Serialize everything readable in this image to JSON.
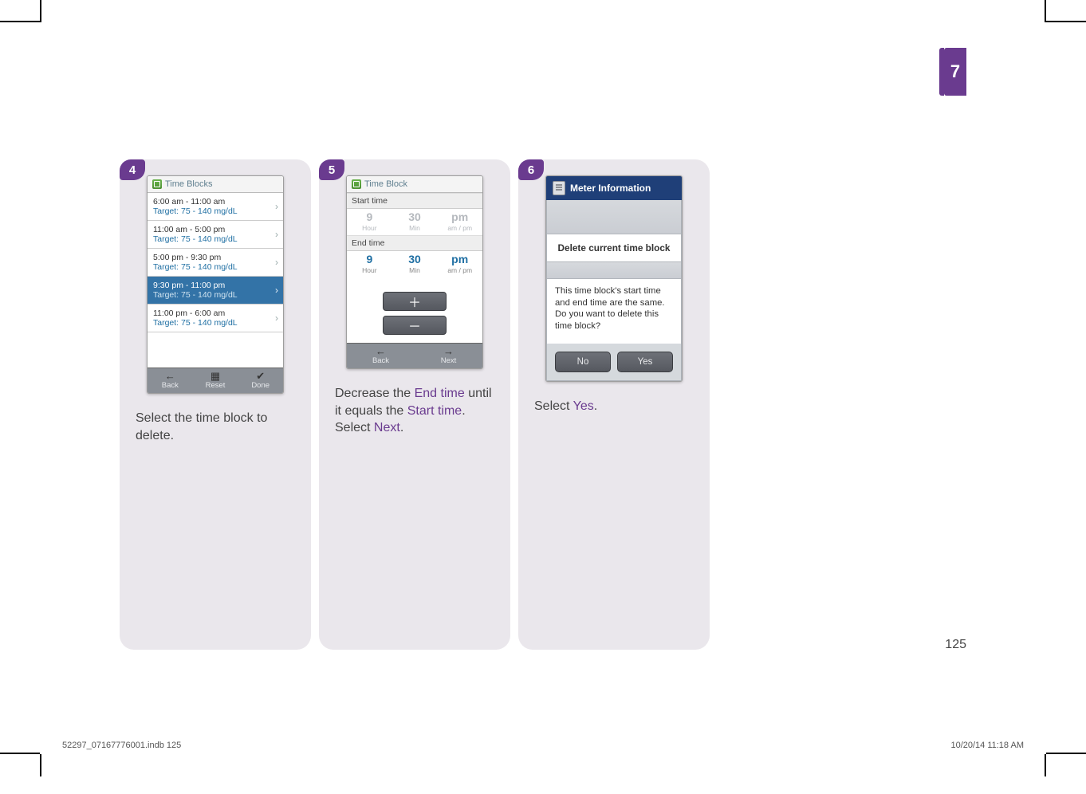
{
  "chapter_tab": "7",
  "page_number": "125",
  "footer": {
    "left": "52297_07167776001.indb   125",
    "right": "10/20/14   11:18 AM"
  },
  "steps": {
    "s4": {
      "badge": "4",
      "header": "Time Blocks",
      "blocks": [
        {
          "time": "6:00 am - 11:00 am",
          "target": "Target: 75 - 140 mg/dL"
        },
        {
          "time": "11:00 am - 5:00 pm",
          "target": "Target: 75 - 140 mg/dL"
        },
        {
          "time": "5:00 pm - 9:30 pm",
          "target": "Target: 75 - 140 mg/dL"
        },
        {
          "time": "9:30 pm - 11:00 pm",
          "target": "Target: 75 - 140 mg/dL"
        },
        {
          "time": "11:00 pm - 6:00 am",
          "target": "Target: 75 - 140 mg/dL"
        }
      ],
      "footerbar": {
        "back": "Back",
        "reset": "Reset",
        "done": "Done"
      },
      "caption_plain": "Select the time block to delete."
    },
    "s5": {
      "badge": "5",
      "header": "Time Block",
      "start_label": "Start time",
      "end_label": "End time",
      "start": {
        "hour": "9",
        "hour_lbl": "Hour",
        "min": "30",
        "min_lbl": "Min",
        "ampm": "pm",
        "ampm_lbl": "am / pm"
      },
      "end": {
        "hour": "9",
        "hour_lbl": "Hour",
        "min": "30",
        "min_lbl": "Min",
        "ampm": "pm",
        "ampm_lbl": "am / pm"
      },
      "footerbar": {
        "back": "Back",
        "next": "Next"
      },
      "caption": {
        "pre": "Decrease the ",
        "t1": "End time",
        "mid1": " until it equals the ",
        "t2": "Start time",
        "mid2": ". Select ",
        "t3": "Next",
        "post": "."
      }
    },
    "s6": {
      "badge": "6",
      "header": "Meter Information",
      "section": "Delete current time block",
      "message": "This time block's start time and end time are the same. Do you want to delete this time block?",
      "no": "No",
      "yes": "Yes",
      "caption": {
        "pre": "Select ",
        "t1": "Yes",
        "post": "."
      }
    }
  }
}
